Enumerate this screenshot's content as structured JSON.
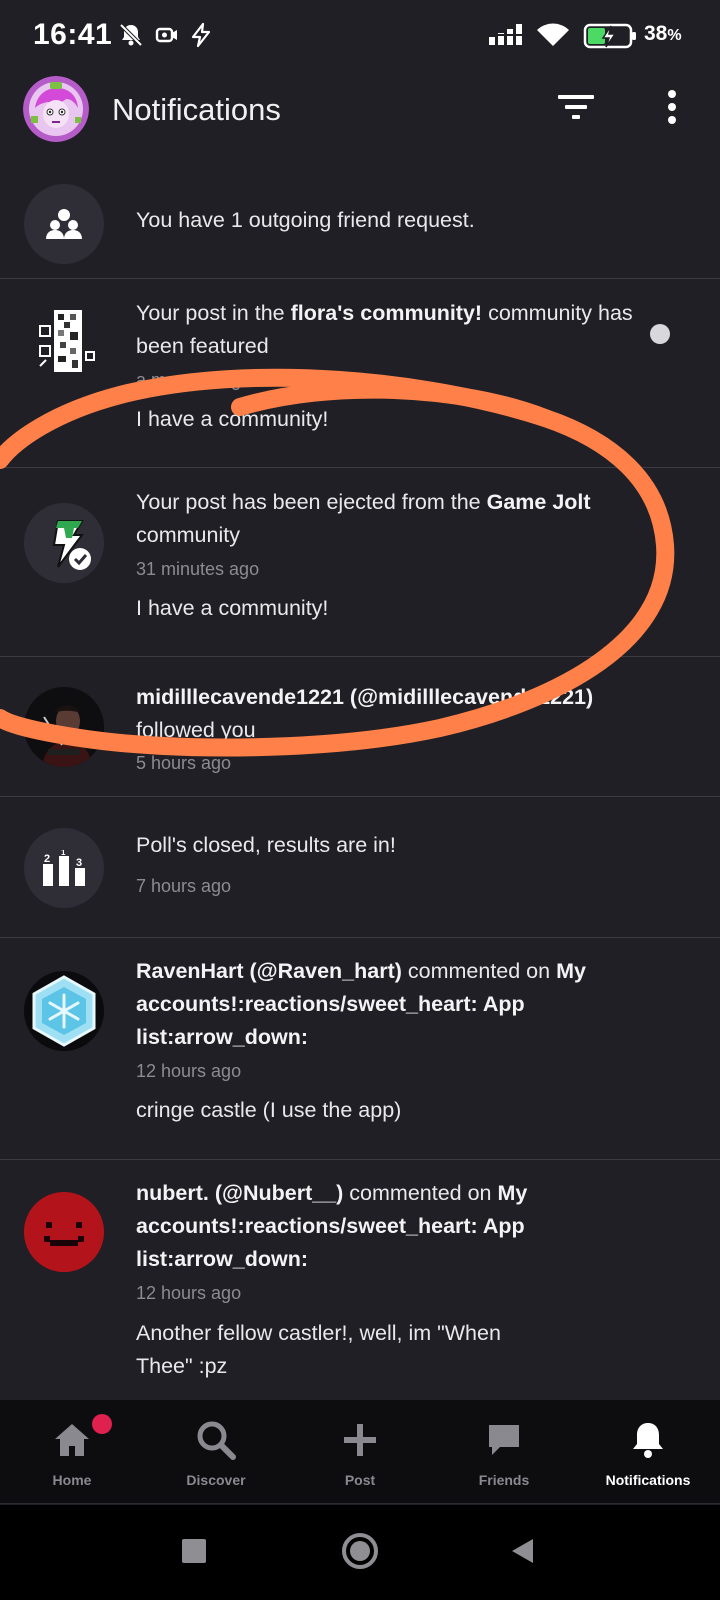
{
  "status_bar": {
    "time": "16:41",
    "battery_percent": "38",
    "battery_unit": "%",
    "battery_level": 0.38,
    "icons": [
      "bell-off-icon",
      "camera-icon",
      "lightning-icon",
      "signal-icon",
      "wifi-icon",
      "battery-charging-icon"
    ]
  },
  "header": {
    "title": "Notifications",
    "filter_icon": "filter-icon",
    "more_icon": "more-vert-icon"
  },
  "notifications": [
    {
      "parts": [
        {
          "t": "You have 1 outgoing friend request.",
          "b": false
        }
      ],
      "time": "",
      "body": "",
      "icon": "friends-group-icon",
      "unread": false
    },
    {
      "parts": [
        {
          "t": "Your post in the ",
          "b": false
        },
        {
          "t": "flora's community!",
          "b": true
        },
        {
          "t": " community has been featured",
          "b": false
        }
      ],
      "time": "a moment ago",
      "body": "I have a community!",
      "icon": "pixel-art-avatar",
      "unread": true
    },
    {
      "parts": [
        {
          "t": "Your post has been ejected from the ",
          "b": false
        },
        {
          "t": "Game Jolt",
          "b": true
        },
        {
          "t": " community",
          "b": false
        }
      ],
      "time": "31 minutes ago",
      "body": "I have a community!",
      "icon": "game-jolt-logo",
      "unread": false
    },
    {
      "parts": [
        {
          "t": "midilllecavende1221 (@midilllecavende1221)",
          "b": true
        },
        {
          "t": " followed you",
          "b": false
        }
      ],
      "time": "5 hours ago",
      "body": "",
      "icon": "user-avatar-dark",
      "unread": false
    },
    {
      "parts": [
        {
          "t": "Poll's closed, results are in!",
          "b": false
        }
      ],
      "time": "7 hours ago",
      "body": "",
      "icon": "poll-icon",
      "unread": false
    },
    {
      "parts": [
        {
          "t": "RavenHart (@Raven_hart)",
          "b": true
        },
        {
          "t": " commented on ",
          "b": false
        },
        {
          "t": "My accounts!:reactions/sweet_heart: App list:arrow_down:",
          "b": true
        }
      ],
      "time": "12 hours ago",
      "body": "cringe castle (I use the app)",
      "icon": "snowflake-avatar",
      "unread": false
    },
    {
      "parts": [
        {
          "t": "nubert. (@Nubert__)",
          "b": true
        },
        {
          "t": " commented on ",
          "b": false
        },
        {
          "t": "My accounts!:reactions/sweet_heart: App list:arrow_down:",
          "b": true
        }
      ],
      "time": "12 hours ago",
      "body": "Another fellow castler!, well, im \"When Thee\" :pz",
      "icon": "red-smile-avatar",
      "unread": false
    }
  ],
  "bottom_nav": [
    {
      "label": "Home",
      "icon": "home-icon",
      "badge": true,
      "active": false
    },
    {
      "label": "Discover",
      "icon": "search-icon",
      "badge": false,
      "active": false
    },
    {
      "label": "Post",
      "icon": "plus-icon",
      "badge": false,
      "active": false
    },
    {
      "label": "Friends",
      "icon": "chat-bubble-icon",
      "badge": false,
      "active": false
    },
    {
      "label": "Notifications",
      "icon": "bell-icon",
      "badge": false,
      "active": true
    }
  ],
  "colors": {
    "background": "#201f26",
    "divider": "#3c3b44",
    "annotation": "#ff8048",
    "badge": "#e0204f"
  }
}
